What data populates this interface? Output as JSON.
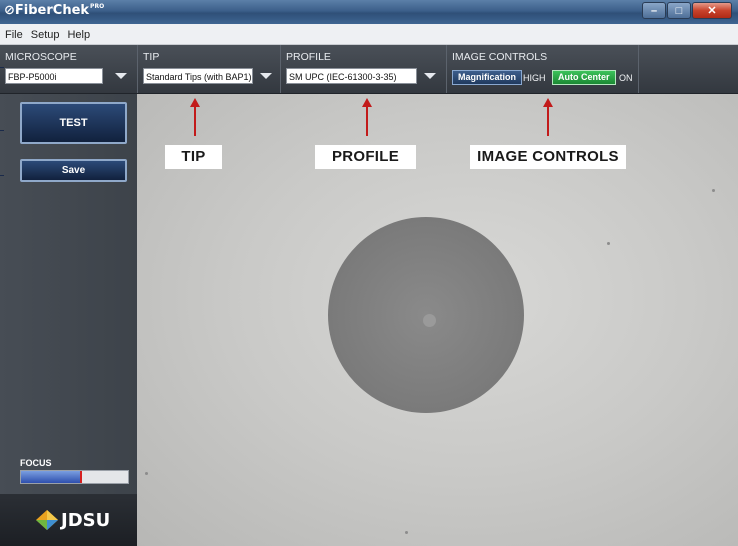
{
  "window": {
    "title": "FiberChek",
    "title_sup": "PRO",
    "minimize": "–",
    "maximize": "□",
    "close": "✕"
  },
  "menu": [
    "File",
    "Setup",
    "Help"
  ],
  "toolbar": {
    "microscope": {
      "label": "MICROSCOPE",
      "value": "FBP-P5000i"
    },
    "tip": {
      "label": "TIP",
      "value": "Standard Tips (with BAP1)"
    },
    "profile": {
      "label": "PROFILE",
      "value": "SM UPC (IEC-61300-3-35)"
    },
    "image_controls": {
      "label": "IMAGE CONTROLS",
      "magnification_button": "Magnification",
      "magnification_value": "HIGH",
      "auto_center_button": "Auto Center",
      "auto_center_value": "ON"
    }
  },
  "left": {
    "test_button": "TEST",
    "save_button": "Save",
    "focus_label": "FOCUS",
    "focus_level": 0.55,
    "logo": "JDSU"
  },
  "callouts": {
    "tip": "TIP",
    "profile": "PROFILE",
    "image_controls": "IMAGE CONTROLS"
  },
  "colors": {
    "accent_red": "#c21a1a",
    "auto_center_green": "#1b8a33",
    "button_navy": "#11213d"
  }
}
